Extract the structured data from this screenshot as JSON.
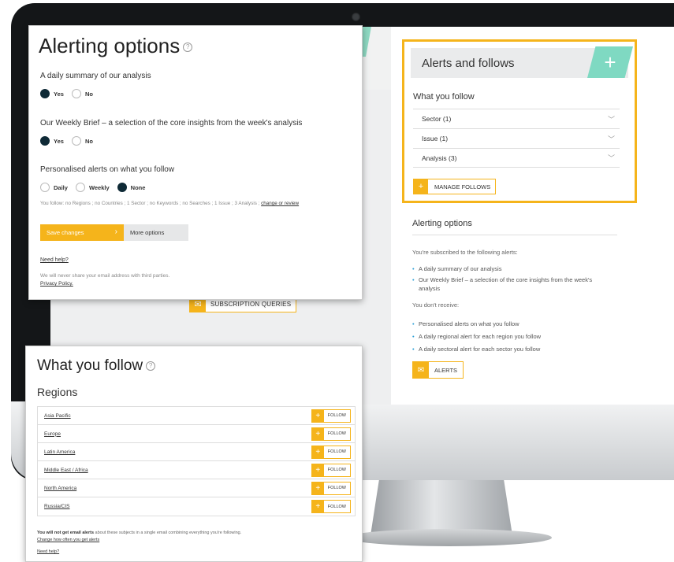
{
  "alerting_panel": {
    "title": "Alerting options",
    "help_glyph": "?",
    "q1": "A daily summary of our analysis",
    "q1_options": [
      "Yes",
      "No"
    ],
    "q2": "Our Weekly Brief – a selection of the core insights from the week's analysis",
    "q2_options": [
      "Yes",
      "No"
    ],
    "q3": "Personalised alerts on what you follow",
    "q3_options": [
      "Daily",
      "Weekly",
      "None"
    ],
    "you_follow_text": "You follow: no Regions ; no Countries ; 1 Sector ; no Keywords ; no Searches ; 1 Issue ; 3 Analysis ;",
    "change_link": "change or review",
    "save_label": "Save changes",
    "more_label": "More options",
    "need_help": "Need help?",
    "never_share": "We will never share your email address with third parties.",
    "privacy": "Privacy Policy."
  },
  "subscription_button": "SUBSCRIPTION QUERIES",
  "alerts_follows": {
    "title": "Alerts and follows",
    "what_you_follow": "What you follow",
    "rows": [
      "Sector (1)",
      "Issue (1)",
      "Analysis (3)"
    ],
    "manage_label": "MANAGE FOLLOWS"
  },
  "alerting_right": {
    "title": "Alerting options",
    "subscribed_intro": "You're subscribed to the following alerts:",
    "subscribed": [
      "A daily summary of our analysis",
      "Our Weekly Brief – a selection of the core insights from the week's analysis"
    ],
    "dont_receive_intro": "You don't receive:",
    "dont_receive": [
      "Personalised alerts on what you follow",
      "A daily regional alert for each region you follow",
      "A daily sectoral alert for each sector you follow"
    ],
    "alerts_label": "ALERTS"
  },
  "follow_panel": {
    "title": "What you follow",
    "regions_heading": "Regions",
    "regions": [
      "Asia Pacific",
      "Europe",
      "Latin America",
      "Middle East / Africa",
      "North America",
      "Russia/CIS"
    ],
    "follow_label": "FOLLOW",
    "no_email_bold": "You will not get email alerts",
    "no_email_rest": " about these subjects in a single email combining everything you're following.",
    "change_link": "Change how often you get alerts",
    "need_help": "Need help?"
  },
  "colors": {
    "accent": "#f5b41b",
    "teal": "#7fd9c2",
    "radio_on": "#0f2a36"
  }
}
